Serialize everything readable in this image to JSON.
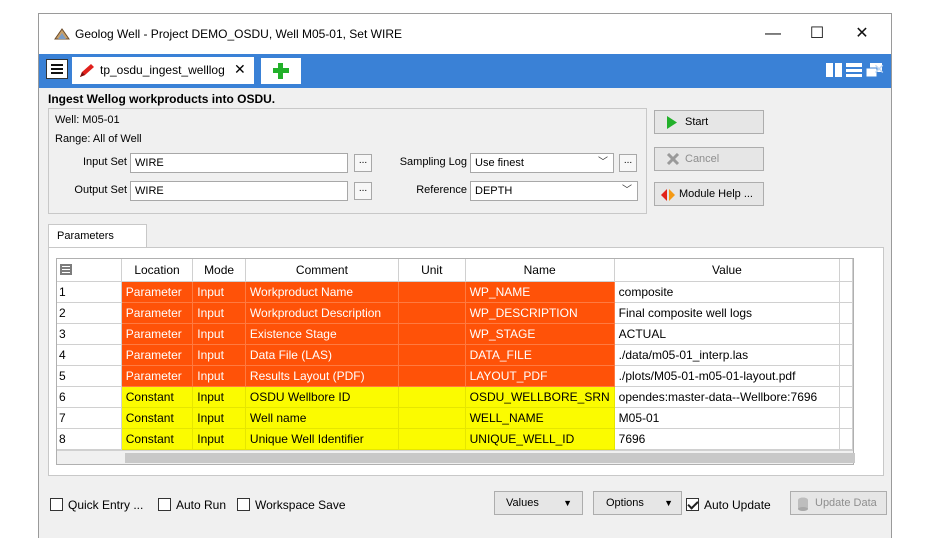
{
  "window": {
    "title": "Geolog Well - Project DEMO_OSDU, Well M05-01, Set WIRE",
    "controls": {
      "minimize": "—",
      "maximize": "☐",
      "close": "✕"
    }
  },
  "tabs": {
    "active_label": "tp_osdu_ingest_welllog",
    "close_glyph": "✕",
    "right_close_glyph": "✕"
  },
  "panel": {
    "title": "Ingest Wellog workproducts into OSDU.",
    "well_info": "Well: M05-01",
    "range_info": "Range: All of Well",
    "input_set_label": "Input Set",
    "input_set_value": "WIRE",
    "output_set_label": "Output Set",
    "output_set_value": "WIRE",
    "sampling_log_label": "Sampling Log",
    "sampling_log_value": "Use finest",
    "reference_label": "Reference",
    "reference_value": "DEPTH",
    "browse_glyph": "...",
    "combo_arrow": "﹀"
  },
  "actions": {
    "start_label": "Start",
    "cancel_label": "Cancel",
    "help_label": "Module Help ..."
  },
  "parameters": {
    "tab_label": "Parameters",
    "columns": [
      "Location",
      "Mode",
      "Comment",
      "Unit",
      "Name",
      "Value"
    ],
    "rows": [
      {
        "num": "1",
        "location": "Parameter",
        "mode": "Input",
        "comment": "Workproduct Name",
        "unit": "",
        "name": "WP_NAME",
        "value": "composite",
        "kind": "param"
      },
      {
        "num": "2",
        "location": "Parameter",
        "mode": "Input",
        "comment": "Workproduct Description",
        "unit": "",
        "name": "WP_DESCRIPTION",
        "value": "Final composite well logs",
        "kind": "param"
      },
      {
        "num": "3",
        "location": "Parameter",
        "mode": "Input",
        "comment": "Existence Stage",
        "unit": "",
        "name": "WP_STAGE",
        "value": "ACTUAL",
        "kind": "param"
      },
      {
        "num": "4",
        "location": "Parameter",
        "mode": "Input",
        "comment": "Data File (LAS)",
        "unit": "",
        "name": "DATA_FILE",
        "value": "./data/m05-01_interp.las",
        "kind": "param"
      },
      {
        "num": "5",
        "location": "Parameter",
        "mode": "Input",
        "comment": "Results Layout (PDF)",
        "unit": "",
        "name": "LAYOUT_PDF",
        "value": "./plots/M05-01-m05-01-layout.pdf",
        "kind": "param"
      },
      {
        "num": "6",
        "location": "Constant",
        "mode": "Input",
        "comment": "OSDU Wellbore ID",
        "unit": "",
        "name": "OSDU_WELLBORE_SRN",
        "value": "opendes:master-data--Wellbore:7696",
        "kind": "const"
      },
      {
        "num": "7",
        "location": "Constant",
        "mode": "Input",
        "comment": "Well name",
        "unit": "",
        "name": "WELL_NAME",
        "value": "M05-01",
        "kind": "const"
      },
      {
        "num": "8",
        "location": "Constant",
        "mode": "Input",
        "comment": "Unique Well Identifier",
        "unit": "",
        "name": "UNIQUE_WELL_ID",
        "value": "7696",
        "kind": "const"
      }
    ]
  },
  "bottom": {
    "quick_entry_label": "Quick Entry ...",
    "quick_entry_checked": false,
    "auto_run_label": "Auto Run",
    "auto_run_checked": false,
    "workspace_save_label": "Workspace Save",
    "workspace_save_checked": false,
    "values_label": "Values",
    "options_label": "Options",
    "auto_update_label": "Auto Update",
    "auto_update_checked": true,
    "update_data_label": "Update Data",
    "menu_arrow": "▼"
  },
  "colors": {
    "tabbar": "#3a81d6",
    "parameter_row": "#ff5208",
    "constant_row": "#fbfb00",
    "start_icon": "#22b02a"
  }
}
